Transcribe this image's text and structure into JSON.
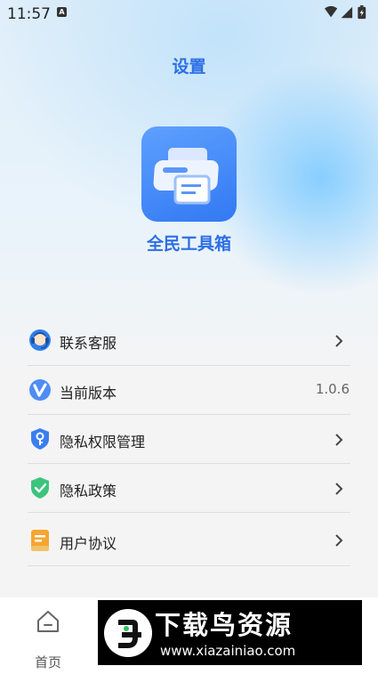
{
  "status_bar": {
    "time": "11:57",
    "notification_letter": "A"
  },
  "header": {
    "title": "设置"
  },
  "app": {
    "name": "全民工具箱",
    "icon": "printer-icon"
  },
  "menu": {
    "items": [
      {
        "label": "联系客服",
        "icon": "customer-service-icon",
        "trailing": "chevron"
      },
      {
        "label": "当前版本",
        "icon": "version-icon",
        "trailing": "value",
        "value": "1.0.6"
      },
      {
        "label": "隐私权限管理",
        "icon": "privacy-key-shield-icon",
        "trailing": "chevron"
      },
      {
        "label": "隐私政策",
        "icon": "privacy-check-shield-icon",
        "trailing": "chevron"
      },
      {
        "label": "用户协议",
        "icon": "user-agreement-icon",
        "trailing": "chevron"
      }
    ]
  },
  "bottom_nav": {
    "home_label": "首页",
    "home_icon": "home-icon"
  },
  "banner": {
    "title": "下载鸟资源",
    "url": "www.xiazainiao.com"
  },
  "colors": {
    "accent": "#2d6fe5",
    "background": "#f4f4f5"
  }
}
